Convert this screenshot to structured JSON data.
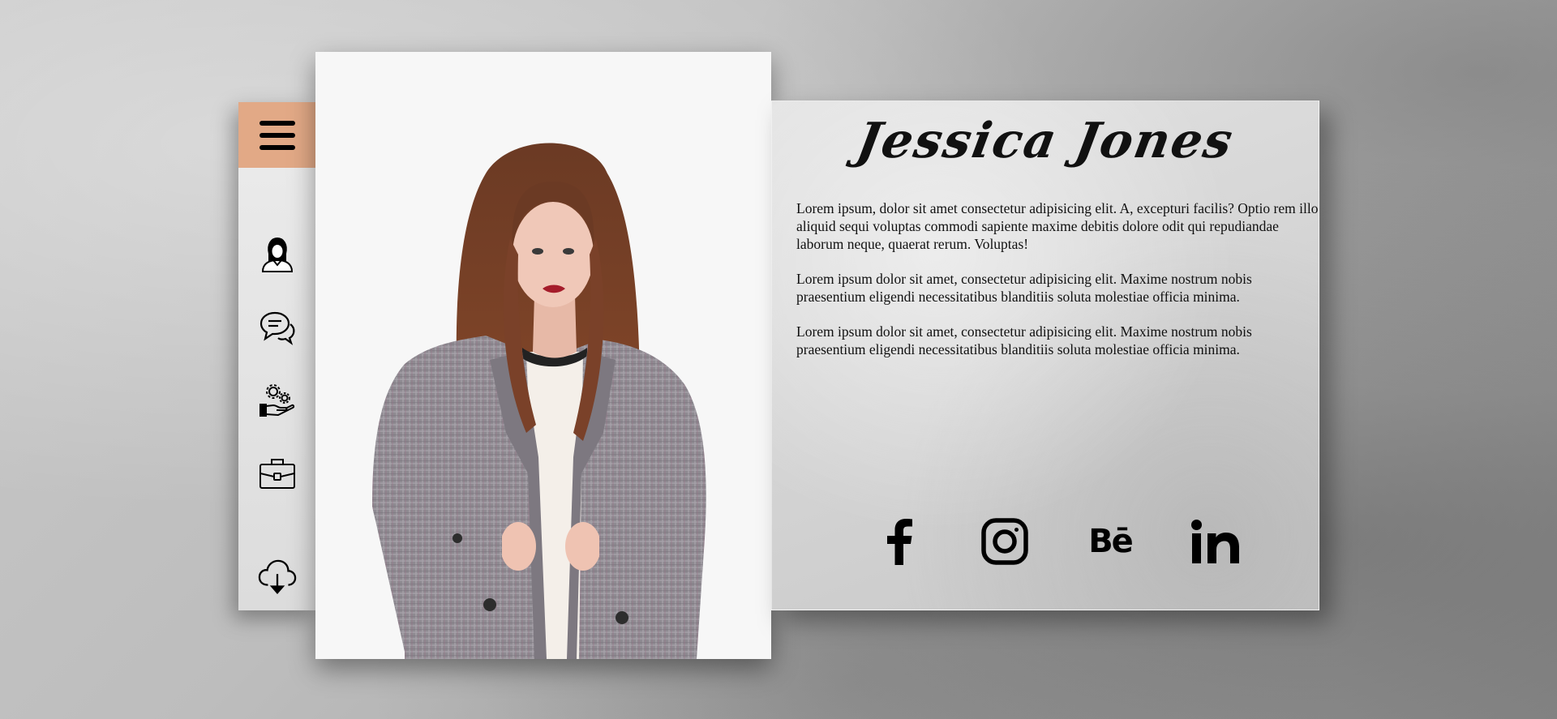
{
  "profile": {
    "name": "Jessica  Jones",
    "bio": [
      "Lorem ipsum, dolor sit amet consectetur adipisicing elit. A, excepturi facilis? Optio rem illo aliquid sequi voluptas commodi sapiente maxime debitis dolore odit qui repudiandae laborum neque, quaerat rerum. Voluptas!",
      "Lorem ipsum dolor sit amet, consectetur adipisicing elit. Maxime nostrum nobis praesentium eligendi necessitatibus blanditiis soluta molestiae officia minima.",
      "Lorem ipsum dolor sit amet, consectetur adipisicing elit. Maxime nostrum nobis praesentium eligendi necessitatibus blanditiis soluta molestiae officia minima."
    ]
  },
  "sidebar": {
    "items": [
      {
        "icon": "menu-icon"
      },
      {
        "icon": "user-icon"
      },
      {
        "icon": "chat-icon"
      },
      {
        "icon": "services-icon"
      },
      {
        "icon": "briefcase-icon"
      },
      {
        "icon": "cloud-download-icon"
      }
    ]
  },
  "socials": [
    {
      "icon": "facebook-icon"
    },
    {
      "icon": "instagram-icon"
    },
    {
      "icon": "behance-icon",
      "text": "Bē"
    },
    {
      "icon": "linkedin-icon"
    }
  ],
  "colors": {
    "accent": "#e2a986",
    "text": "#111111"
  }
}
